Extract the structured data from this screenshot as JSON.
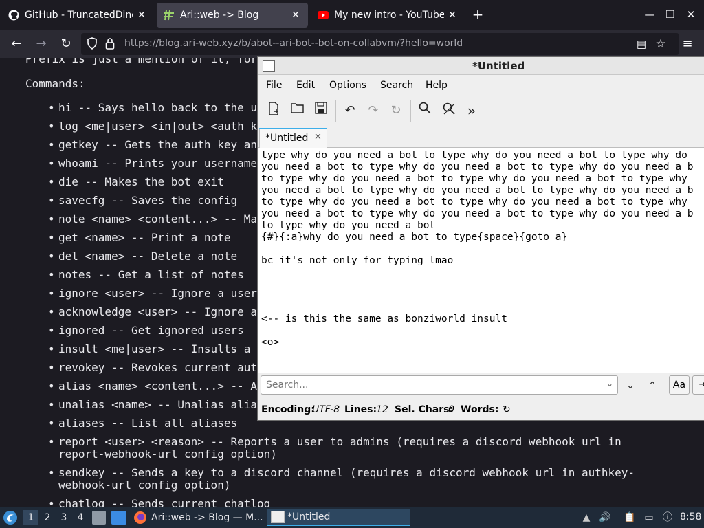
{
  "browser": {
    "tabs": [
      {
        "title": "GitHub - TruncatedDinos",
        "icon": "github-icon",
        "active": false
      },
      {
        "title": "Ari::web -> Blog",
        "icon": "ari-web-icon",
        "active": true
      },
      {
        "title": "My new intro - YouTube",
        "icon": "youtube-icon",
        "active": false
      }
    ],
    "new_tab_label": "+",
    "url_host": "https://blog.ari-web.xyz",
    "url_path": "/b/abot--ari-bot--bot-on-collabvm/?hello=world"
  },
  "page": {
    "prefix_line": "Prefix is just a mention of it, for",
    "commands_heading": "Commands:",
    "commands": [
      "hi -- Says hello back to the u",
      "log <me|user> <in|out> <auth k",
      "getkey -- Gets the auth key an",
      "whoami -- Prints your username",
      "die -- Makes the bot exit",
      "savecfg -- Saves the config",
      "note <name> <content...> -- Ma",
      "get <name> -- Print a note",
      "del <name> -- Delete a note",
      "notes -- Get a list of notes",
      "ignore <user> -- Ignore a user",
      "acknowledge <user> -- Ignore a",
      "ignored -- Get ignored users",
      "insult <me|user> -- Insults a",
      "revokey -- Revokes current aut",
      "alias <name> <content...> -- A",
      "unalias <name> -- Unalias alia",
      "aliases -- List all aliases",
      "report <user> <reason> -- Reports a user to admins (requires a discord webhook url in",
      "sendkey -- Sends a key to a discord channel (requires a discord webhook url in authkey-",
      "chatlog -- Sends current chatlog"
    ],
    "command_continuations": [
      "report-webhook-url config option)",
      "webhook-url config option)"
    ]
  },
  "editor": {
    "title": "*Untitled",
    "menus": [
      "File",
      "Edit",
      "Options",
      "Search",
      "Help"
    ],
    "tab_label": "*Untitled",
    "lines": [
      "type why do you need a bot to type why do you need a bot to type why do",
      "you need a bot to type why do you need a bot to type why do you need a b",
      "to type why do you need a bot to type why do you need a bot to type why",
      "you need a bot to type why do you need a bot to type why do you need a b",
      "to type why do you need a bot to type why do you need a bot to type why",
      "you need a bot to type why do you need a bot to type why do you need a b",
      "to type why do you need a bot",
      "{#}{:a}why do you need a bot to type{space}{goto a}",
      "",
      "bc it's not only for typing lmao",
      "",
      "",
      "",
      "",
      "<-- is this the same as bonziworld insult",
      "",
      "<o>"
    ],
    "search_placeholder": "Search...",
    "case_label": "Aa",
    "status": {
      "encoding_label": "Encoding:",
      "encoding_value": "UTF-8",
      "lines_label": "Lines:",
      "lines_value": "12",
      "sel_label": "Sel. Chars:",
      "sel_value": "0",
      "words_label": "Words:"
    }
  },
  "taskbar": {
    "workspaces": [
      "1",
      "2",
      "3",
      "4"
    ],
    "tasks": [
      {
        "title": "Ari::web -> Blog — M...",
        "icon": "firefox-icon"
      },
      {
        "title": "*Untitled",
        "icon": "editor-icon"
      }
    ],
    "clock": "8:58"
  }
}
